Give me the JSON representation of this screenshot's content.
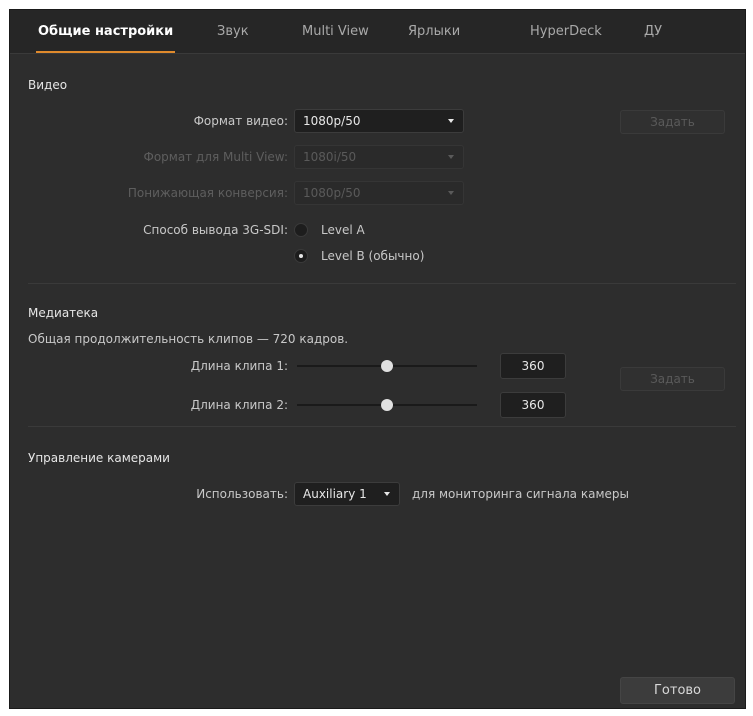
{
  "tabs": [
    {
      "label": "Общие настройки",
      "active": true
    },
    {
      "label": "Звук",
      "active": false
    },
    {
      "label": "Multi View",
      "active": false
    },
    {
      "label": "Ярлыки",
      "active": false
    },
    {
      "label": "HyperDeck",
      "active": false
    },
    {
      "label": "ДУ",
      "active": false
    }
  ],
  "video": {
    "title": "Видео",
    "format_label": "Формат видео:",
    "format_value": "1080p/50",
    "multiview_label": "Формат для Multi View:",
    "multiview_value": "1080i/50",
    "downconv_label": "Понижающая конверсия:",
    "downconv_value": "1080p/50",
    "sdi_label": "Способ вывода 3G-SDI:",
    "sdi_options": [
      {
        "label": "Level A",
        "selected": false
      },
      {
        "label": "Level B (обычно)",
        "selected": true
      }
    ],
    "set_button": "Задать"
  },
  "media": {
    "title": "Медиатека",
    "total_text": "Общая продолжительность клипов — 720 кадров.",
    "clip1_label": "Длина клипа 1:",
    "clip1_value": "360",
    "clip1_fraction": 0.5,
    "clip2_label": "Длина клипа 2:",
    "clip2_value": "360",
    "clip2_fraction": 0.5,
    "set_button": "Задать"
  },
  "camera": {
    "title": "Управление камерами",
    "use_label": "Использовать:",
    "use_value": "Auxiliary 1",
    "use_suffix": "для мониторинга сигнала камеры"
  },
  "footer": {
    "done_button": "Готово"
  },
  "colors": {
    "accent": "#e08a2c",
    "background": "#2d2d2d"
  }
}
